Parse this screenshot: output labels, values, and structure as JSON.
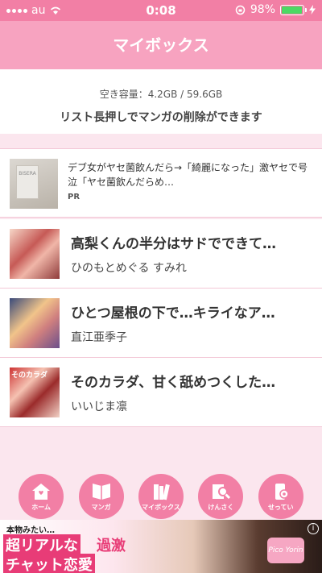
{
  "status_bar": {
    "carrier": "au",
    "time": "0:08",
    "battery": "98%",
    "battery_level": 0.98
  },
  "header": {
    "title": "マイボックス"
  },
  "info": {
    "capacity": "空き容量：4.2GB / 59.6GB",
    "note": "リスト長押しでマンガの削除ができます"
  },
  "ad": {
    "thumb_label": "BISERA",
    "text": "デブ女がヤセ菌飲んだら→「綺麗になった」激ヤセで号泣「ヤセ菌飲んだらめ…",
    "badge": "PR"
  },
  "manga": [
    {
      "title": "高梨くんの半分はサドでできて…",
      "author": "ひのもとめぐる すみれ",
      "cover_label": ""
    },
    {
      "title": "ひとつ屋根の下で…キライなア…",
      "author": "直江亜季子",
      "cover_label": ""
    },
    {
      "title": "そのカラダ、甘く舐めつくした…",
      "author": "いいじま凛",
      "cover_label": "そのカラダ"
    }
  ],
  "nav": [
    {
      "label": "ホーム",
      "icon": "home-icon"
    },
    {
      "label": "マンガ",
      "icon": "book-icon"
    },
    {
      "label": "マイボックス",
      "icon": "mybox-icon"
    },
    {
      "label": "けんさく",
      "icon": "search-icon"
    },
    {
      "label": "せってい",
      "icon": "settings-icon"
    }
  ],
  "banner": {
    "small": "本物みたい…",
    "line1": "超リアルな",
    "accent": "過激",
    "line2": "チャット恋愛",
    "brand": "Pico Yorin"
  },
  "colors": {
    "accent": "#f27fa5",
    "header": "#f7a3c0",
    "background": "#fbe6ee"
  }
}
